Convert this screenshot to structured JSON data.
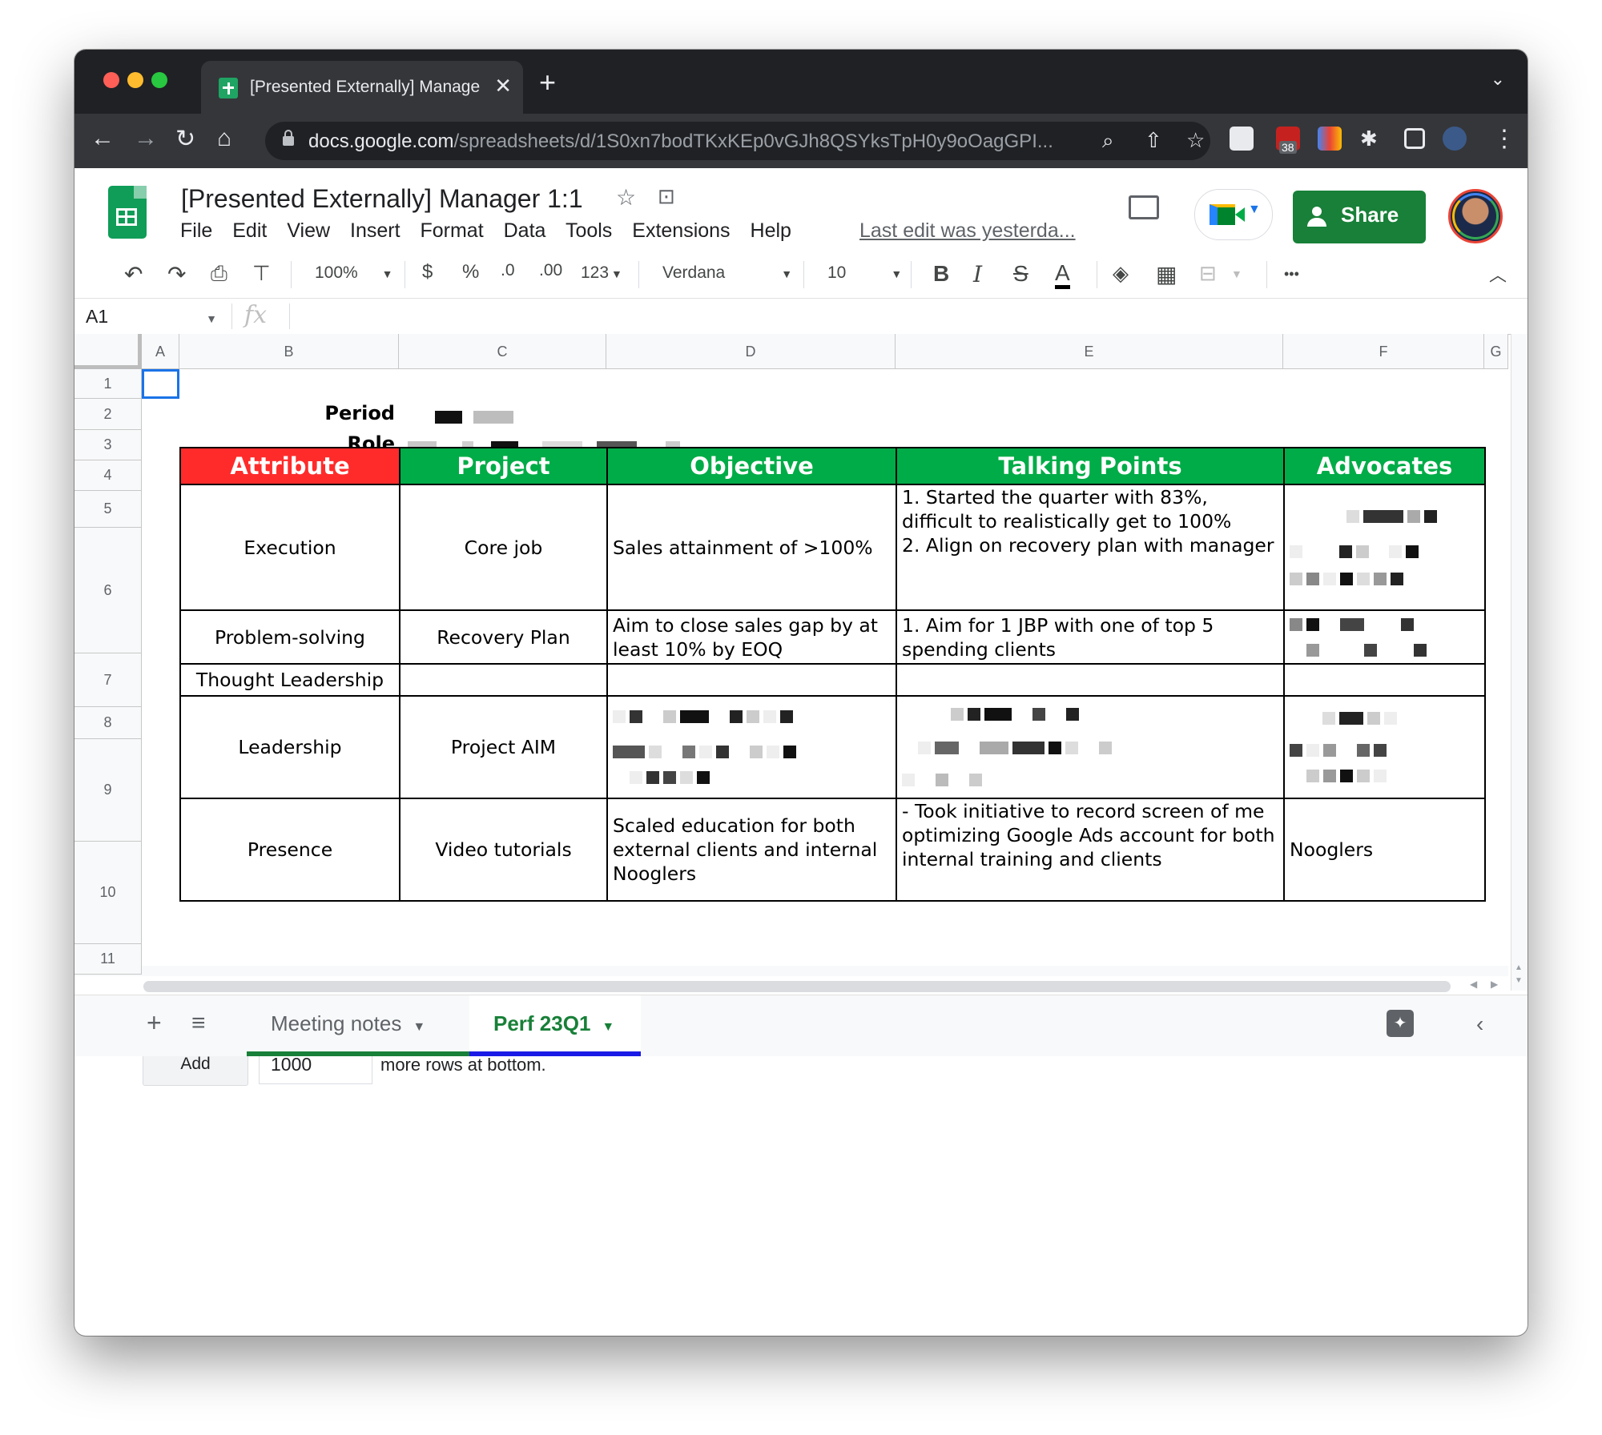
{
  "browser": {
    "tab_title": "[Presented Externally] Manage",
    "url_host": "docs.google.com",
    "url_path": "/spreadsheets/d/1S0xn7bodTKxKEp0vGJh8QSYksTpH0y9oOagGPI...",
    "extension_badge": "38"
  },
  "app": {
    "title": "[Presented Externally] Manager 1:1",
    "menus": [
      "File",
      "Edit",
      "View",
      "Insert",
      "Format",
      "Data",
      "Tools",
      "Extensions",
      "Help"
    ],
    "last_edit": "Last edit was yesterda...",
    "share_label": "Share"
  },
  "toolbar": {
    "zoom": "100%",
    "currency": "$",
    "percent": "%",
    "dec_decrease": ".0",
    "dec_increase": ".00",
    "number_format": "123",
    "font": "Verdana",
    "font_size": "10",
    "bold": "B",
    "italic": "I",
    "strike": "S",
    "text_color": "A",
    "more": "•••"
  },
  "formula_bar": {
    "cell_ref": "A1",
    "fx": "fx"
  },
  "columns": [
    "A",
    "B",
    "C",
    "D",
    "E",
    "F",
    "G"
  ],
  "rows": [
    "1",
    "2",
    "3",
    "4",
    "5",
    "6",
    "7",
    "8",
    "9",
    "10",
    "11"
  ],
  "labels": {
    "period": "Period",
    "role": "Role"
  },
  "table": {
    "headers": [
      "Attribute",
      "Project",
      "Objective",
      "Talking Points",
      "Advocates"
    ],
    "header_colors": {
      "attribute": "#ff2b2b",
      "others": "#00ac47"
    },
    "rows": [
      {
        "attribute": "Execution",
        "project": "Core job",
        "objective": "Sales attainment of >100%",
        "talking_points": "1. Started the quarter with 83%, difficult to realistically get to 100%\n2. Align on recovery plan with manager",
        "advocates": ""
      },
      {
        "attribute": "Problem-solving",
        "project": "Recovery Plan",
        "objective": "Aim to close sales gap by at least 10% by EOQ",
        "talking_points": "1. Aim for 1 JBP with one of top 5 spending clients",
        "advocates": ""
      },
      {
        "attribute": "Thought Leadership",
        "project": "",
        "objective": "",
        "talking_points": "",
        "advocates": ""
      },
      {
        "attribute": "Leadership",
        "project": "Project AIM",
        "objective": "",
        "talking_points": "",
        "advocates": ""
      },
      {
        "attribute": "Presence",
        "project": "Video tutorials",
        "objective": "Scaled education for both external clients and internal Nooglers",
        "talking_points": "- Took initiative to record screen of me optimizing Google Ads account for both internal training and clients",
        "advocates": "Nooglers"
      }
    ]
  },
  "add_rows": {
    "button": "Add",
    "count": "1000",
    "suffix": "more rows at bottom."
  },
  "sheets": [
    {
      "name": "Meeting notes",
      "active": false,
      "color": "#188038"
    },
    {
      "name": "Perf 23Q1",
      "active": true,
      "color": "#1a1ae6"
    }
  ]
}
